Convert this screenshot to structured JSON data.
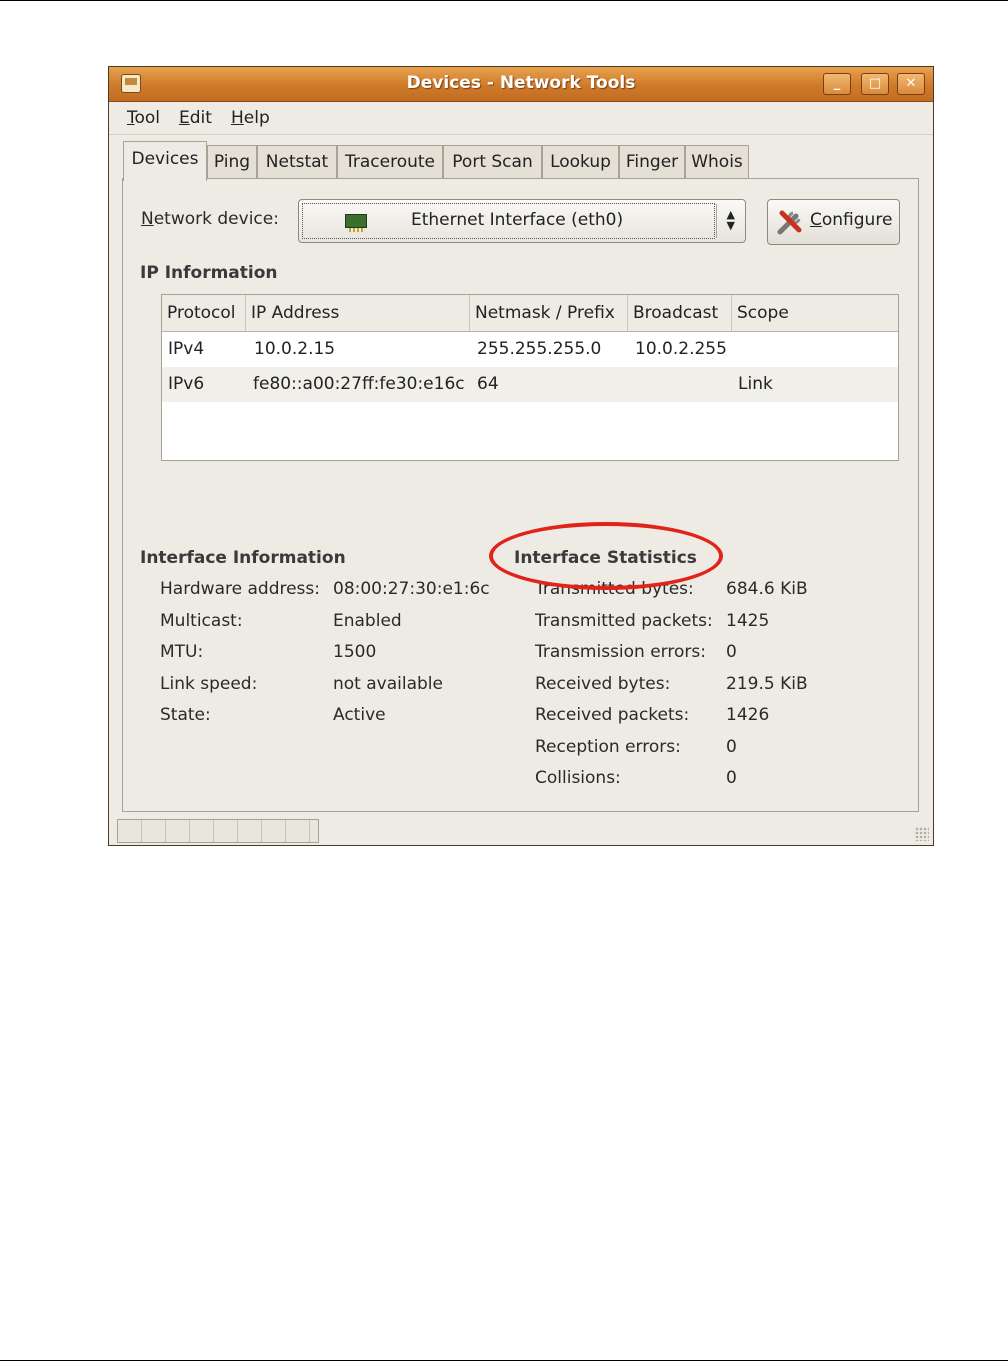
{
  "window": {
    "title": "Devices - Network Tools",
    "controls": [
      "_",
      "□",
      "✕"
    ]
  },
  "menu": [
    {
      "mnemonic": "T",
      "rest": "ool"
    },
    {
      "mnemonic": "E",
      "rest": "dit"
    },
    {
      "mnemonic": "H",
      "rest": "elp"
    }
  ],
  "tabs": [
    "Devices",
    "Ping",
    "Netstat",
    "Traceroute",
    "Port Scan",
    "Lookup",
    "Finger",
    "Whois"
  ],
  "active_tab": "Devices",
  "device": {
    "label_mnemonic": "N",
    "label_rest": "etwork device:",
    "selected": "Ethernet Interface (eth0)",
    "icon": "network-card-icon",
    "configure_mnemonic": "C",
    "configure_rest": "onfigure"
  },
  "ip_info": {
    "heading": "IP Information",
    "columns": [
      "Protocol",
      "IP Address",
      "Netmask / Prefix",
      "Broadcast",
      "Scope"
    ],
    "rows": [
      [
        "IPv4",
        "10.0.2.15",
        "255.255.255.0",
        "10.0.2.255",
        ""
      ],
      [
        "IPv6",
        "fe80::a00:27ff:fe30:e16c",
        "64",
        "",
        "Link"
      ]
    ]
  },
  "interface_info": {
    "heading": "Interface Information",
    "labels": [
      "Hardware address:",
      "Multicast:",
      "MTU:",
      "Link speed:",
      "State:"
    ],
    "values": [
      "08:00:27:30:e1:6c",
      "Enabled",
      "1500",
      "not available",
      "Active"
    ]
  },
  "interface_stats": {
    "heading": "Interface Statistics",
    "labels": [
      "Transmitted bytes:",
      "Transmitted packets:",
      "Transmission errors:",
      "Received bytes:",
      "Received packets:",
      "Reception errors:",
      "Collisions:"
    ],
    "values": [
      "684.6 KiB",
      "1425",
      "0",
      "219.5 KiB",
      "1426",
      "0",
      "0"
    ]
  },
  "colors": {
    "titlebar": "#cf7a2a",
    "highlight_ellipse": "#e2231a",
    "window_bg": "#edebe4"
  }
}
